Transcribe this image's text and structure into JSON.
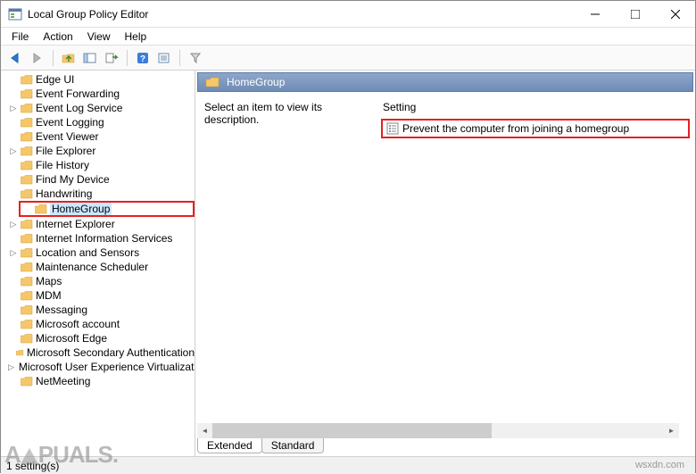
{
  "window": {
    "title": "Local Group Policy Editor"
  },
  "menu": {
    "items": [
      "File",
      "Action",
      "View",
      "Help"
    ]
  },
  "toolbar": {
    "icons": [
      "back-arrow-icon",
      "forward-arrow-icon",
      "up-folder-icon",
      "show-hide-tree-icon",
      "export-icon",
      "help-icon",
      "properties-icon",
      "filter-icon"
    ]
  },
  "tree": {
    "items": [
      {
        "label": "Edge UI",
        "expandable": false
      },
      {
        "label": "Event Forwarding",
        "expandable": false
      },
      {
        "label": "Event Log Service",
        "expandable": true
      },
      {
        "label": "Event Logging",
        "expandable": false
      },
      {
        "label": "Event Viewer",
        "expandable": false
      },
      {
        "label": "File Explorer",
        "expandable": true
      },
      {
        "label": "File History",
        "expandable": false
      },
      {
        "label": "Find My Device",
        "expandable": false
      },
      {
        "label": "Handwriting",
        "expandable": false
      },
      {
        "label": "HomeGroup",
        "expandable": false,
        "selected": true,
        "highlighted": true
      },
      {
        "label": "Internet Explorer",
        "expandable": true
      },
      {
        "label": "Internet Information Services",
        "expandable": false
      },
      {
        "label": "Location and Sensors",
        "expandable": true
      },
      {
        "label": "Maintenance Scheduler",
        "expandable": false
      },
      {
        "label": "Maps",
        "expandable": false
      },
      {
        "label": "MDM",
        "expandable": false
      },
      {
        "label": "Messaging",
        "expandable": false
      },
      {
        "label": "Microsoft account",
        "expandable": false
      },
      {
        "label": "Microsoft Edge",
        "expandable": false
      },
      {
        "label": "Microsoft Secondary Authentication",
        "expandable": false
      },
      {
        "label": "Microsoft User Experience Virtualization",
        "expandable": true
      },
      {
        "label": "NetMeeting",
        "expandable": false
      }
    ]
  },
  "details": {
    "header": "HomeGroup",
    "description_prompt": "Select an item to view its description.",
    "column_header": "Setting",
    "settings": [
      {
        "label": "Prevent the computer from joining a homegroup",
        "highlighted": true
      }
    ]
  },
  "tabs": {
    "extended": "Extended",
    "standard": "Standard"
  },
  "status": {
    "text": "1 setting(s)"
  },
  "watermark": {
    "site": "wsxdn.com",
    "logo": "PUALS."
  }
}
